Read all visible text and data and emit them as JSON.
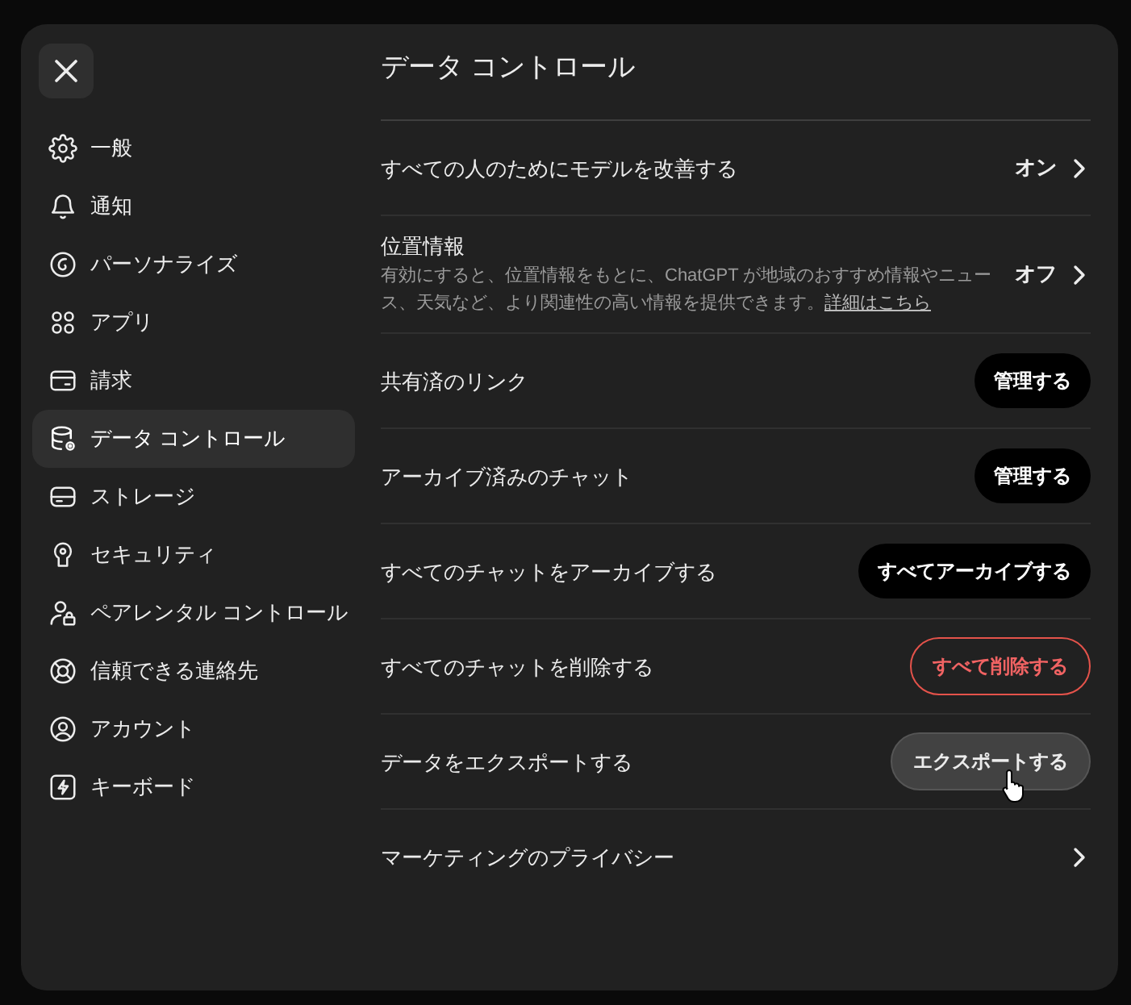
{
  "sidebar": {
    "items": [
      {
        "label": "一般",
        "selected": false
      },
      {
        "label": "通知",
        "selected": false
      },
      {
        "label": "パーソナライズ",
        "selected": false
      },
      {
        "label": "アプリ",
        "selected": false
      },
      {
        "label": "請求",
        "selected": false
      },
      {
        "label": "データ コントロール",
        "selected": true
      },
      {
        "label": "ストレージ",
        "selected": false
      },
      {
        "label": "セキュリティ",
        "selected": false
      },
      {
        "label": "ペアレンタル コントロール",
        "selected": false
      },
      {
        "label": "信頼できる連絡先",
        "selected": false
      },
      {
        "label": "アカウント",
        "selected": false
      },
      {
        "label": "キーボード",
        "selected": false
      }
    ]
  },
  "page": {
    "title": "データ コントロール"
  },
  "settings": [
    {
      "kind": "value",
      "label": "すべての人のためにモデルを改善する",
      "value": "オン"
    },
    {
      "kind": "value",
      "label": "位置情報",
      "description": "有効にすると、位置情報をもとに、ChatGPT が地域のおすすめ情報やニュース、天気など、より関連性の高い情報を提供できます。",
      "link": "詳細はこちら",
      "value": "オフ"
    },
    {
      "kind": "button",
      "label": "共有済のリンク",
      "button": {
        "label": "管理する",
        "kind": "primary",
        "hovered": false
      }
    },
    {
      "kind": "button",
      "label": "アーカイブ済みのチャット",
      "button": {
        "label": "管理する",
        "kind": "primary",
        "hovered": false
      }
    },
    {
      "kind": "button",
      "label": "すべてのチャットをアーカイブする",
      "button": {
        "label": "すべてアーカイブする",
        "kind": "primary",
        "hovered": false
      }
    },
    {
      "kind": "button",
      "label": "すべてのチャットを削除する",
      "button": {
        "label": "すべて削除する",
        "kind": "danger",
        "hovered": false
      }
    },
    {
      "kind": "button",
      "label": "データをエクスポートする",
      "button": {
        "label": "エクスポートする",
        "kind": "secondary",
        "hovered": true
      }
    },
    {
      "kind": "link",
      "label": "マーケティングのプライバシー"
    }
  ]
}
